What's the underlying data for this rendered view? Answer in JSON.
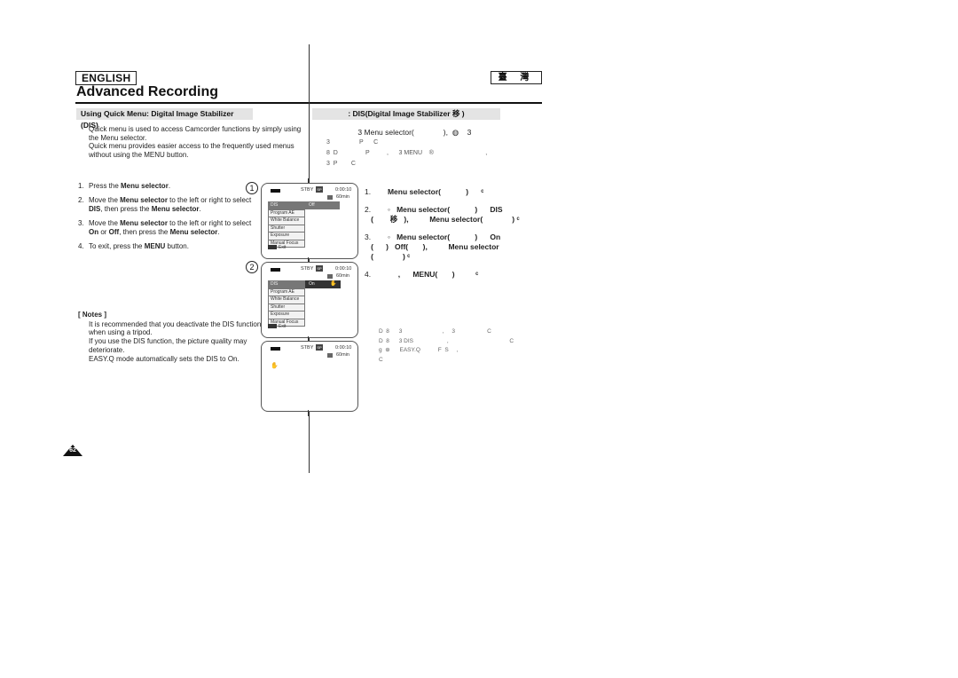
{
  "header": {
    "language_left": "ENGLISH",
    "language_right": "臺 灣",
    "title": "Advanced Recording"
  },
  "section": {
    "title_left": "Using Quick Menu: Digital Image Stabilizer (DIS)",
    "title_right": ": DIS(Digital Image Stabilizer        移  )"
  },
  "intro": [
    "Quick menu is used to access Camcorder functions by simply using the Menu selector.",
    "Quick menu provides easier access to the frequently used menus without using the MENU button."
  ],
  "steps": [
    {
      "num": "1.",
      "parts": [
        [
          "Press the ",
          false
        ],
        [
          "Menu selector",
          true
        ],
        [
          ".",
          false
        ]
      ]
    },
    {
      "num": "2.",
      "parts": [
        [
          "Move the ",
          false
        ],
        [
          "Menu selector",
          true
        ],
        [
          " to the left or right to select ",
          false
        ],
        [
          "DIS",
          true
        ],
        [
          ", then press the ",
          false
        ],
        [
          "Menu selector",
          true
        ],
        [
          ".",
          false
        ]
      ]
    },
    {
      "num": "3.",
      "parts": [
        [
          "Move the ",
          false
        ],
        [
          "Menu selector",
          true
        ],
        [
          " to the left or right to select ",
          false
        ],
        [
          "On",
          true
        ],
        [
          " or ",
          false
        ],
        [
          "Off",
          true
        ],
        [
          ", then press the ",
          false
        ],
        [
          "Menu selector",
          true
        ],
        [
          ".",
          false
        ]
      ]
    },
    {
      "num": "4.",
      "parts": [
        [
          "To exit, press the ",
          false
        ],
        [
          "MENU",
          true
        ],
        [
          " button.",
          false
        ]
      ]
    }
  ],
  "notes": {
    "header": "[ Notes ]",
    "items": [
      "It is recommended that you deactivate the DIS function when using a tripod.",
      "If you use the DIS function, the picture quality may deteriorate.",
      "EASY.Q mode automatically sets the DIS to On."
    ]
  },
  "screens": {
    "common": {
      "status": "STBY",
      "mode": "SP",
      "timecode": "0:00:10",
      "remaining": "60min",
      "exit_label": "Exit",
      "menu_items": [
        "DIS",
        "Program AE",
        "White Balance",
        "Shutter",
        "Exposure",
        "Manual Focus"
      ]
    },
    "screen1": {
      "marker": "1",
      "selected_value": "Off"
    },
    "screen2": {
      "marker": "2",
      "selected_value": "On"
    },
    "screen3": {
      "dis_icon": "✋"
    }
  },
  "right": {
    "intro_rows": [
      "               3 Menu selector(              ),  ◍    3",
      "3                 P      C",
      "8  D                P          ,      3 MENU    ®                              ,",
      "3  P        C"
    ],
    "steps": [
      {
        "num": "1.",
        "lines": [
          "           Menu selector(            )      ᶜ"
        ]
      },
      {
        "num": "2.",
        "lines": [
          "           ◦   Menu selector(            )      DIS",
          "   (        移   ),          Menu selector(              ) ᶜ"
        ]
      },
      {
        "num": "3.",
        "lines": [
          "           ◦   Menu selector(            )      On",
          "   (      )   Off(       ),          Menu selector",
          "   (              ) ᶜ"
        ]
      },
      {
        "num": "4.",
        "lines": [
          "                ,      MENU(       )          ᶜ"
        ]
      }
    ],
    "notes_rows": [
      "D  8      3                         ,     3                    C",
      "D  8      3 DIS                     ,                                      C",
      "g  ⊕      EASY.Q           F  S     ,",
      "C"
    ]
  },
  "footer": {
    "page_number": "62"
  }
}
